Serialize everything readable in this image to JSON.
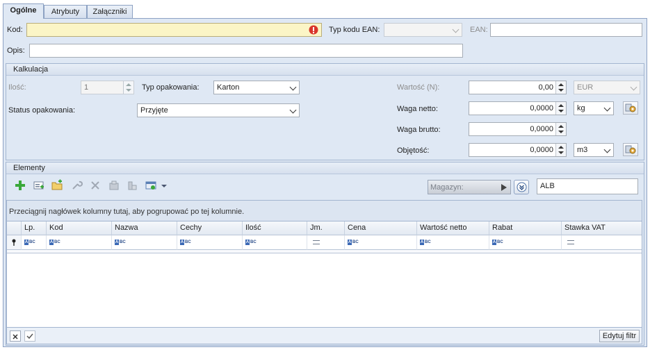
{
  "tabs": [
    {
      "label": "Ogólne"
    },
    {
      "label": "Atrybuty"
    },
    {
      "label": "Załączniki"
    }
  ],
  "general": {
    "kod_label": "Kod:",
    "kod_value": "",
    "typ_ean_label": "Typ kodu EAN:",
    "typ_ean_value": "",
    "ean_label": "EAN:",
    "ean_value": "",
    "opis_label": "Opis:",
    "opis_value": ""
  },
  "kalkulacja": {
    "title": "Kalkulacja",
    "ilosc_label": "Ilość:",
    "ilosc_value": "1",
    "typ_opakowania_label": "Typ opakowania:",
    "typ_opakowania_value": "Karton",
    "status_label": "Status opakowania:",
    "status_value": "Przyjęte",
    "wartosc_label": "Wartość (N):",
    "wartosc_value": "0,00",
    "wartosc_currency": "EUR",
    "waga_netto_label": "Waga netto:",
    "waga_netto_value": "0,0000",
    "waga_netto_unit": "kg",
    "waga_brutto_label": "Waga brutto:",
    "waga_brutto_value": "0,0000",
    "objetosc_label": "Objętość:",
    "objetosc_value": "0,0000",
    "objetosc_unit": "m3"
  },
  "elementy": {
    "title": "Elementy",
    "magazyn_label": "Magazyn:",
    "magazyn_value": "ALB",
    "group_hint": "Przeciągnij nagłówek kolumny tutaj, aby pogrupować po tej kolumnie.",
    "columns": [
      "Lp.",
      "Kod",
      "Nazwa",
      "Cechy",
      "Ilość",
      "Jm.",
      "Cena",
      "Wartość netto",
      "Rabat",
      "Stawka VAT"
    ],
    "edit_filter_label": "Edytuj filtr"
  },
  "colors": {
    "panel_bg": "#dfe8f4",
    "required_bg": "#fbf5c6",
    "error_icon": "#d9362b",
    "add_icon": "#3aa83a"
  }
}
